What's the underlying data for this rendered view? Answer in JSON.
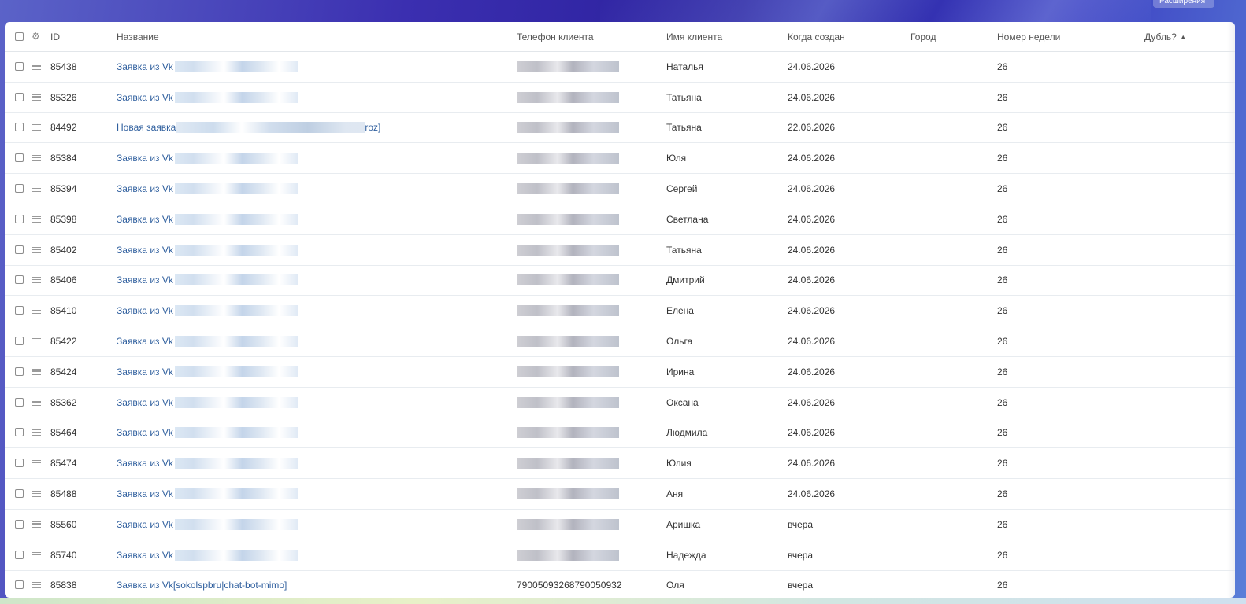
{
  "top_right": {
    "extensions_label": "Расширения"
  },
  "table": {
    "columns": {
      "id": "ID",
      "name": "Название",
      "phone": "Телефон клиента",
      "client": "Имя клиента",
      "created": "Когда создан",
      "city": "Город",
      "week": "Номер недели",
      "duplicate": "Дубль?"
    },
    "sort_indicator": "^",
    "rows": [
      {
        "id": "85438",
        "name_prefix": "Заявка из Vk",
        "name_suffix": "",
        "phone": "",
        "client": "Наталья",
        "created": "24.06.2026",
        "city": "",
        "week": "26",
        "dup": ""
      },
      {
        "id": "85326",
        "name_prefix": "Заявка из Vk",
        "name_suffix": "",
        "phone": "",
        "client": "Татьяна",
        "created": "24.06.2026",
        "city": "",
        "week": "26",
        "dup": ""
      },
      {
        "id": "84492",
        "name_prefix": "Новая заявка",
        "name_suffix": "roz]",
        "phone": "",
        "client": "Татьяна",
        "created": "22.06.2026",
        "city": "",
        "week": "26",
        "dup": ""
      },
      {
        "id": "85384",
        "name_prefix": "Заявка из Vk",
        "name_suffix": "",
        "phone": "",
        "client": "Юля",
        "created": "24.06.2026",
        "city": "",
        "week": "26",
        "dup": ""
      },
      {
        "id": "85394",
        "name_prefix": "Заявка из Vk",
        "name_suffix": "",
        "phone": "",
        "client": "Сергей",
        "created": "24.06.2026",
        "city": "",
        "week": "26",
        "dup": ""
      },
      {
        "id": "85398",
        "name_prefix": "Заявка из Vk",
        "name_suffix": "",
        "phone": "",
        "client": "Светлана",
        "created": "24.06.2026",
        "city": "",
        "week": "26",
        "dup": ""
      },
      {
        "id": "85402",
        "name_prefix": "Заявка из Vk",
        "name_suffix": "",
        "phone": "",
        "client": "Татьяна",
        "created": "24.06.2026",
        "city": "",
        "week": "26",
        "dup": ""
      },
      {
        "id": "85406",
        "name_prefix": "Заявка из Vk",
        "name_suffix": "",
        "phone": "",
        "client": "Дмитрий",
        "created": "24.06.2026",
        "city": "",
        "week": "26",
        "dup": ""
      },
      {
        "id": "85410",
        "name_prefix": "Заявка из Vk",
        "name_suffix": "",
        "phone": "",
        "client": "Елена",
        "created": "24.06.2026",
        "city": "",
        "week": "26",
        "dup": ""
      },
      {
        "id": "85422",
        "name_prefix": "Заявка из Vk",
        "name_suffix": "",
        "phone": "",
        "client": "Ольга",
        "created": "24.06.2026",
        "city": "",
        "week": "26",
        "dup": ""
      },
      {
        "id": "85424",
        "name_prefix": "Заявка из Vk",
        "name_suffix": "",
        "phone": "",
        "client": "Ирина",
        "created": "24.06.2026",
        "city": "",
        "week": "26",
        "dup": ""
      },
      {
        "id": "85362",
        "name_prefix": "Заявка из Vk",
        "name_suffix": "",
        "phone": "",
        "client": "Оксана",
        "created": "24.06.2026",
        "city": "",
        "week": "26",
        "dup": ""
      },
      {
        "id": "85464",
        "name_prefix": "Заявка из Vk",
        "name_suffix": "",
        "phone": "",
        "client": "Людмила",
        "created": "24.06.2026",
        "city": "",
        "week": "26",
        "dup": ""
      },
      {
        "id": "85474",
        "name_prefix": "Заявка из Vk",
        "name_suffix": "",
        "phone": "",
        "client": "Юлия",
        "created": "24.06.2026",
        "city": "",
        "week": "26",
        "dup": ""
      },
      {
        "id": "85488",
        "name_prefix": "Заявка из Vk",
        "name_suffix": "",
        "phone": "",
        "client": "Аня",
        "created": "24.06.2026",
        "city": "",
        "week": "26",
        "dup": ""
      },
      {
        "id": "85560",
        "name_prefix": "Заявка из Vk",
        "name_suffix": "",
        "phone": "",
        "client": "Аришка",
        "created": "вчера",
        "city": "",
        "week": "26",
        "dup": ""
      },
      {
        "id": "85740",
        "name_prefix": "Заявка из Vk",
        "name_suffix": "",
        "phone": "",
        "client": "Надежда",
        "created": "вчера",
        "city": "",
        "week": "26",
        "dup": ""
      },
      {
        "id": "85838",
        "name_prefix": "Заявка из Vk",
        "name_suffix": " [sokolspbru|chat-bot-mimo]",
        "phone": "79005093268790050932",
        "client": "Оля",
        "created": "вчера",
        "city": "",
        "week": "26",
        "dup": ""
      }
    ]
  }
}
